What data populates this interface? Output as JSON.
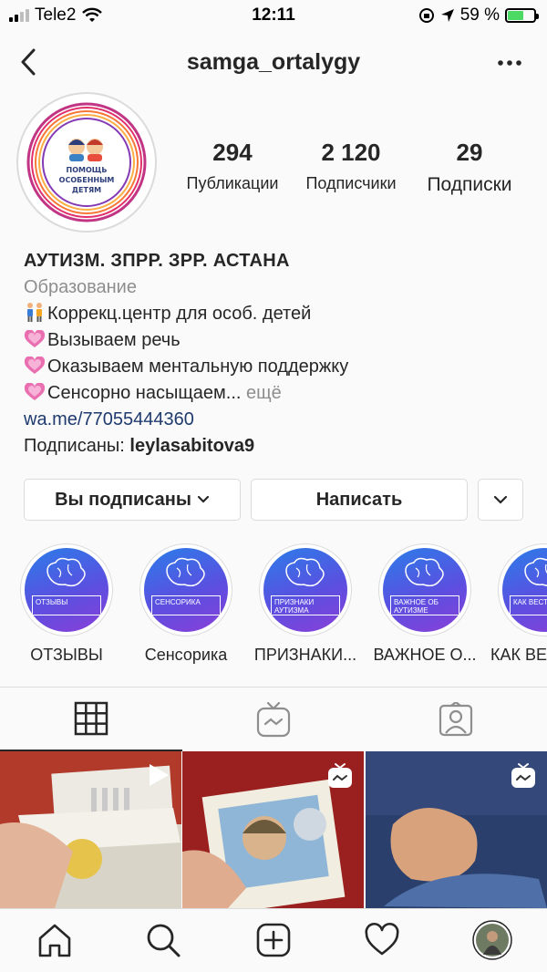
{
  "status_bar": {
    "carrier": "Tele2",
    "time": "12:11",
    "battery": "59 %",
    "battery_level": 0.59,
    "icons": [
      "signal-icon",
      "wifi-icon",
      "orientation-lock-icon",
      "location-icon",
      "battery-icon"
    ]
  },
  "header": {
    "username": "samga_ortalygy",
    "back_icon": "chevron-left-icon",
    "more_icon": "more-horizontal-icon"
  },
  "profile": {
    "avatar_text": [
      "ПОМОЩЬ",
      "ОСОБЕННЫМ",
      "ДЕТЯМ"
    ],
    "stats": [
      {
        "value": "294",
        "label": "Публикации"
      },
      {
        "value": "2 120",
        "label": "Подписчики"
      },
      {
        "value": "29",
        "label": "Подписки"
      }
    ]
  },
  "bio": {
    "name": "АУТИЗМ. ЗПРР. ЗРР. АСТАНА",
    "category": "Образование",
    "lines": [
      "Коррекц.центр для особ. детей",
      "Вызываем речь",
      "Оказываем ментальную поддержку",
      "Сенсорно насыщаем..."
    ],
    "more": "ещё",
    "link": "wa.me/77055444360",
    "followed_by_prefix": "Подписаны:",
    "followed_by_user": "leylasabitova9"
  },
  "actions": {
    "following": "Вы подписаны",
    "message": "Написать"
  },
  "highlights": [
    {
      "label": "ОТЗЫВЫ",
      "cover_text": "ОТЗЫВЫ"
    },
    {
      "label": "Сенсорика",
      "cover_text": "СЕНСОРИКА"
    },
    {
      "label": "ПРИЗНАКИ...",
      "cover_text": "ПРИЗНАКИ АУТИЗМА"
    },
    {
      "label": "ВАЖНОЕ О...",
      "cover_text": "ВАЖНОЕ ОБ АУТИЗМЕ"
    },
    {
      "label": "КАК ВЕ",
      "cover_text": "КАК ВЕСТИ СЕБЯ"
    }
  ],
  "tabs": [
    {
      "name": "grid",
      "icon": "grid-icon",
      "active": true
    },
    {
      "name": "igtv",
      "icon": "igtv-icon",
      "active": false
    },
    {
      "name": "tagged",
      "icon": "tagged-icon",
      "active": false
    }
  ],
  "posts": [
    {
      "type": "video",
      "badge_icon": "play-icon"
    },
    {
      "type": "igtv",
      "badge_icon": "igtv-icon"
    },
    {
      "type": "igtv",
      "badge_icon": "igtv-icon"
    }
  ],
  "bottom_nav": [
    "home-icon",
    "search-icon",
    "new-post-icon",
    "activity-icon",
    "profile-avatar"
  ],
  "colors": {
    "link": "#1e3a6e",
    "secondary_text": "#8e8e8e",
    "border": "#dbdbdb",
    "highlight_gradient_start": "#2b7de9",
    "highlight_gradient_end": "#8a3fd8",
    "battery_green": "#4cd964"
  }
}
